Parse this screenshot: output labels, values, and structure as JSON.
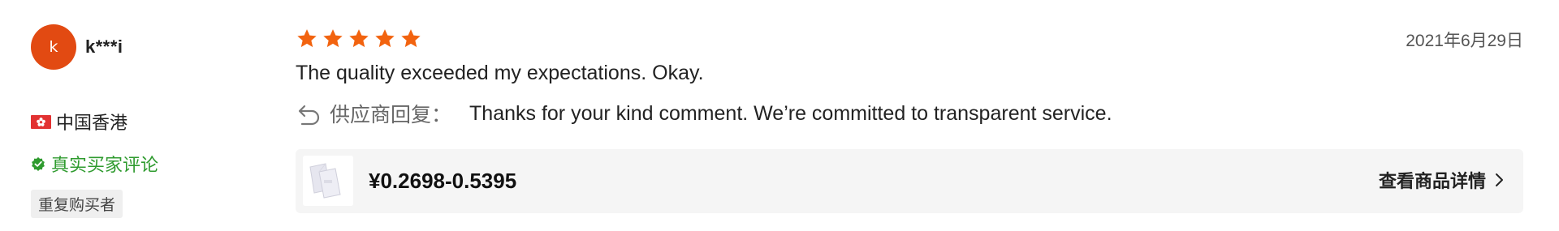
{
  "reviewer": {
    "avatar_initial": "k",
    "avatar_color": "#e24a12",
    "username": "k***i",
    "country": "中国香港",
    "verified_label": "真实买家评论",
    "repeat_buyer_label": "重复购买者"
  },
  "review": {
    "rating": 5,
    "max_rating": 5,
    "date": "2021年6月29日",
    "text": "The quality exceeded my expectations. Okay."
  },
  "reply": {
    "icon": "reply-icon",
    "label": "供应商回复：",
    "text": "Thanks for your kind comment. We’re committed to transparent service."
  },
  "product": {
    "price": "¥0.2698-0.5395",
    "details_label": "查看商品详情",
    "icon": "chevron-right-icon"
  },
  "colors": {
    "star": "#f2630f",
    "verified": "#2f9b2f",
    "flag": "#e23232"
  }
}
